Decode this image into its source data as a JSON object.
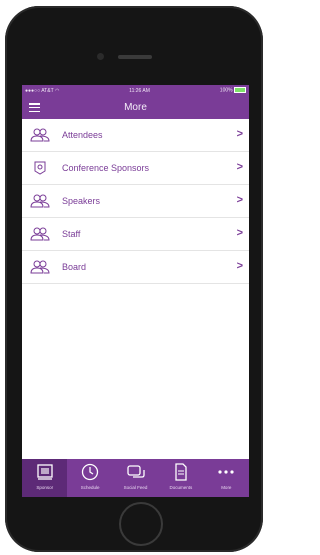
{
  "status": {
    "carrier": "AT&T",
    "time": "11:26 AM",
    "battery": "100%"
  },
  "nav": {
    "title": "More"
  },
  "list": {
    "items": [
      {
        "label": "Attendees"
      },
      {
        "label": "Conference Sponsors"
      },
      {
        "label": "Speakers"
      },
      {
        "label": "Staff"
      },
      {
        "label": "Board"
      }
    ]
  },
  "tabs": [
    {
      "label": "Sponsor",
      "icon": "sponsor-icon"
    },
    {
      "label": "Schedule",
      "icon": "clock-icon"
    },
    {
      "label": "Social Feed",
      "icon": "chat-icon"
    },
    {
      "label": "Documents",
      "icon": "document-icon"
    },
    {
      "label": "More",
      "icon": "more-icon"
    }
  ],
  "colors": {
    "accent": "#7a3c97",
    "accent_dark": "#5d2a77"
  }
}
